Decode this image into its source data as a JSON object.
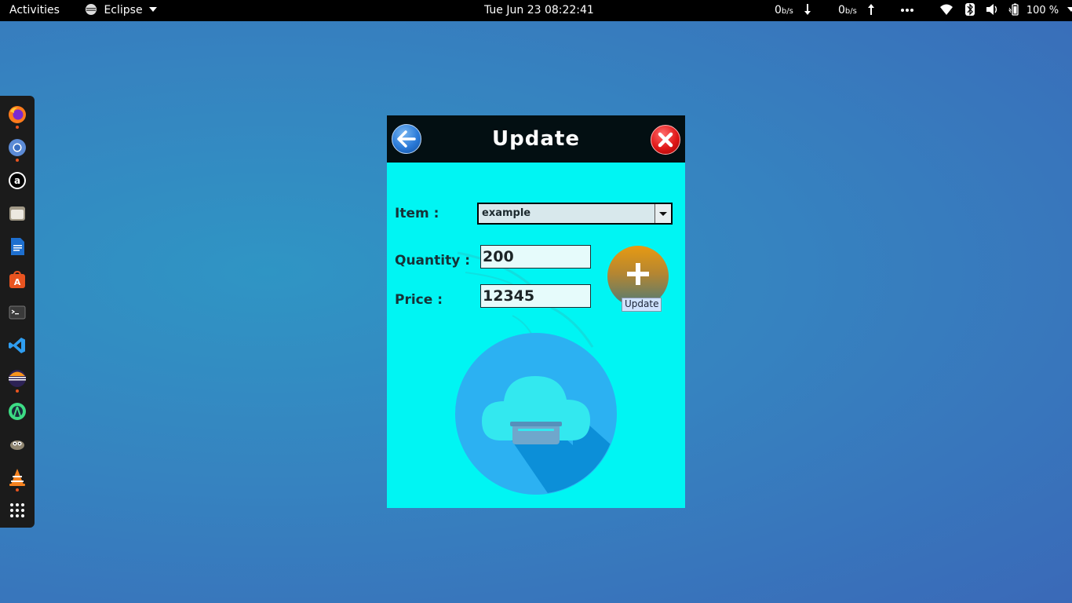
{
  "topbar": {
    "activities": "Activities",
    "app_name": "Eclipse",
    "clock": "Tue Jun 23  08:22:41",
    "net_down_value": "0",
    "net_down_unit": "b/s",
    "net_up_value": "0",
    "net_up_unit": "b/s",
    "battery": "100 %"
  },
  "dock": {
    "apps": [
      "firefox-icon",
      "chromium-icon",
      "amazon-icon",
      "files-icon",
      "writer-icon",
      "app-center-icon",
      "terminal-icon",
      "vscode-icon",
      "eclipse-icon",
      "android-studio-icon",
      "gimp-icon",
      "vlc-icon",
      "show-apps-icon"
    ]
  },
  "window": {
    "title": "Update",
    "item_label": "Item :",
    "item_selected": "example",
    "quantity_label": "Quantity :",
    "quantity_value": "200",
    "price_label": "Price :",
    "price_value": "12345",
    "tooltip": "Update"
  },
  "colors": {
    "window_bg": "#00f5f3",
    "titlebar_bg": "#030f12",
    "accent_orange": "#e79a12"
  }
}
